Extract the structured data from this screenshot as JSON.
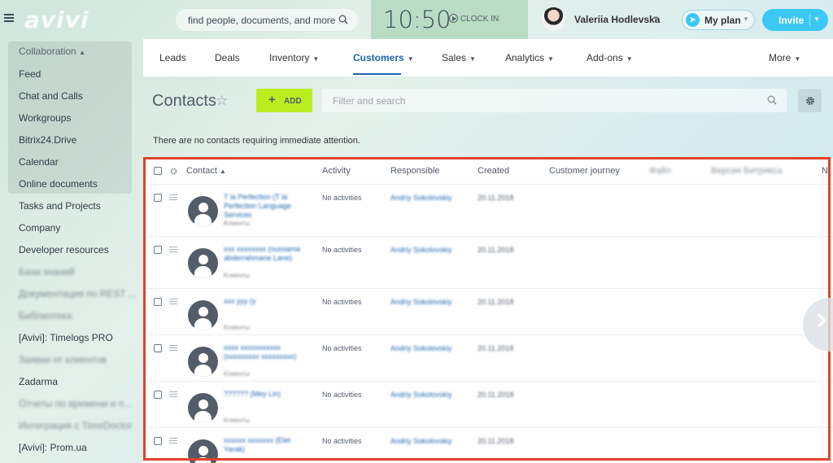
{
  "header": {
    "logo": "avivi",
    "search_placeholder": "find people, documents, and more",
    "time": "10:50",
    "clock_in": "CLOCK IN",
    "user_name": "Valeriia Hodlevska",
    "plan_label": "My plan",
    "invite_label": "Invite"
  },
  "sidebar": {
    "group_title": "Collaboration",
    "items": [
      {
        "label": "Feed",
        "blurred": false
      },
      {
        "label": "Chat and Calls",
        "blurred": false
      },
      {
        "label": "Workgroups",
        "blurred": false
      },
      {
        "label": "Bitrix24.Drive",
        "blurred": false
      },
      {
        "label": "Calendar",
        "blurred": false
      },
      {
        "label": "Online documents",
        "blurred": false
      },
      {
        "label": "Tasks and Projects",
        "blurred": false
      },
      {
        "label": "Company",
        "blurred": false
      },
      {
        "label": "Developer resources",
        "blurred": false
      },
      {
        "label": "База знаний",
        "blurred": true
      },
      {
        "label": "Документация по REST ...",
        "blurred": true
      },
      {
        "label": "Библиотека",
        "blurred": true
      },
      {
        "label": "[Avivi]: Timelogs PRO",
        "blurred": false
      },
      {
        "label": "Заявки от клиентов",
        "blurred": true
      },
      {
        "label": "Zadarma",
        "blurred": false
      },
      {
        "label": "Отчеты по времени и п...",
        "blurred": true
      },
      {
        "label": "Интеграция с TimeDoctor",
        "blurred": true
      },
      {
        "label": "[Avivi]: Prom.ua",
        "blurred": false
      }
    ]
  },
  "nav": {
    "tabs": [
      {
        "label": "Leads",
        "dropdown": false,
        "active": false
      },
      {
        "label": "Deals",
        "dropdown": false,
        "active": false
      },
      {
        "label": "Inventory",
        "dropdown": true,
        "active": false
      },
      {
        "label": "Customers",
        "dropdown": true,
        "active": true
      },
      {
        "label": "Sales",
        "dropdown": true,
        "active": false
      },
      {
        "label": "Analytics",
        "dropdown": true,
        "active": false
      },
      {
        "label": "Add-ons",
        "dropdown": true,
        "active": false
      }
    ],
    "more_label": "More"
  },
  "page": {
    "title": "Contacts",
    "add_label": "ADD",
    "filter_placeholder": "Filter and search",
    "notice": "There are no contacts requiring immediate attention."
  },
  "grid": {
    "columns": [
      "Contact",
      "Activity",
      "Responsible",
      "Created",
      "Customer journey",
      "Файл",
      "Версия Битрикса",
      "N"
    ],
    "rows": [
      {
        "name": "T la Perfection (T la Perfection Language Services",
        "type": "Клиенты",
        "activity": "No activities",
        "responsible": "Andriy Sokolovskiy",
        "created": "20.11.2018"
      },
      {
        "name": "xxx xxxxxxxx (oussama abderrahmane Lane)",
        "type": "Клиенты",
        "activity": "No activities",
        "responsible": "Andriy Sokolovskiy",
        "created": "20.11.2018"
      },
      {
        "name": "xxx yyy (y",
        "type": "Клиенты",
        "activity": "No activities",
        "responsible": "Andriy Sokolovskiy",
        "created": "20.11.2018"
      },
      {
        "name": "xxxx xxxxxxxxxxx (xxxxxxxxx xxxxxxxxx)",
        "type": "Клиенты",
        "activity": "No activities",
        "responsible": "Andriy Sokolovskiy",
        "created": "20.11.2018"
      },
      {
        "name": "?????? (Mey Lin)",
        "type": "Клиенты",
        "activity": "No activities",
        "responsible": "Andriy Sokolovskiy",
        "created": "20.11.2018"
      },
      {
        "name": "xxxxxx xxxxxxx (Elet Yarak)",
        "type": "",
        "activity": "No activities",
        "responsible": "Andriy Sokolovskiy",
        "created": "20.11.2018"
      }
    ]
  },
  "colors": {
    "accent": "#2067b0",
    "add_button": "#bbed21",
    "invite_button": "#3bc8f5",
    "highlight_frame": "#e0432c",
    "clock_panel": "#b9dcc4"
  }
}
